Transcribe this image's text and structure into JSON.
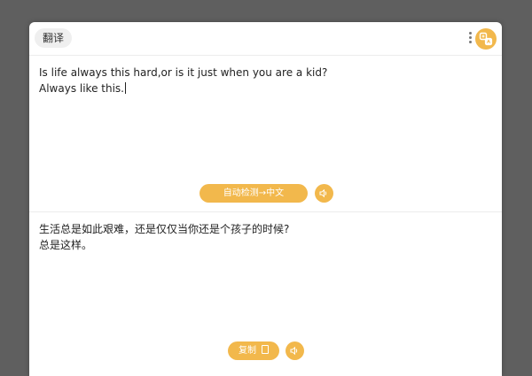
{
  "header": {
    "title": "翻译",
    "menu_icon": "more-vertical-icon",
    "logo_icon": "translate-logo-icon"
  },
  "source": {
    "lines": [
      "Is life always this hard,or is it just when you are a kid?",
      "Always like this."
    ],
    "language_button": "自动检测→中文",
    "speak_icon": "speaker-icon"
  },
  "result": {
    "lines": [
      "生活总是如此艰难，还是仅仅当你还是个孩子的时候?",
      "总是这样。"
    ],
    "copy_button": "复制",
    "copy_icon": "copy-icon",
    "speak_icon": "speaker-icon"
  },
  "colors": {
    "accent": "#f2b84c",
    "background": "#5f5f5f",
    "panel": "#ffffff"
  }
}
